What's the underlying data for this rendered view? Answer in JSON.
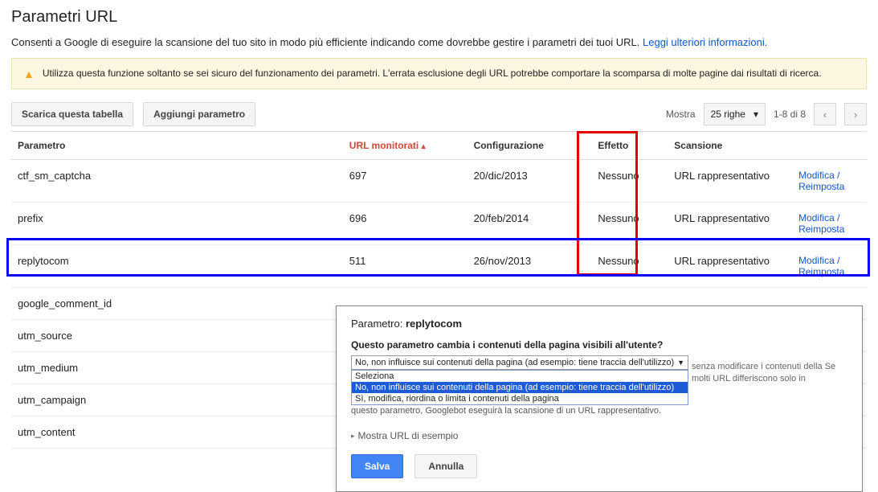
{
  "page": {
    "title": "Parametri URL",
    "subtitle": "Consenti a Google di eseguire la scansione del tuo sito in modo più efficiente indicando come dovrebbe gestire i parametri dei tuoi URL.",
    "learn_more": "Leggi ulteriori informazioni."
  },
  "warning": "Utilizza questa funzione soltanto se sei sicuro del funzionamento dei parametri. L'errata esclusione degli URL potrebbe comportare la scomparsa di molte pagine dai risultati di ricerca.",
  "toolbar": {
    "download": "Scarica questa tabella",
    "add": "Aggiungi parametro",
    "show_label": "Mostra",
    "rows_select": "25 righe",
    "range": "1-8 di 8"
  },
  "table": {
    "headers": {
      "param": "Parametro",
      "monitored": "URL monitorati",
      "config": "Configurazione",
      "effect": "Effetto",
      "scan": "Scansione"
    },
    "rows": [
      {
        "param": "ctf_sm_captcha",
        "monitored": "697",
        "config": "20/dic/2013",
        "effect": "Nessuno",
        "scan": "URL rappresentativo"
      },
      {
        "param": "prefix",
        "monitored": "696",
        "config": "20/feb/2014",
        "effect": "Nessuno",
        "scan": "URL rappresentativo"
      },
      {
        "param": "replytocom",
        "monitored": "511",
        "config": "26/nov/2013",
        "effect": "Nessuno",
        "scan": "URL rappresentativo"
      },
      {
        "param": "google_comment_id"
      },
      {
        "param": "utm_source"
      },
      {
        "param": "utm_medium"
      },
      {
        "param": "utm_campaign"
      },
      {
        "param": "utm_content"
      }
    ],
    "action_edit": "Modifica",
    "action_reset": "Reimposta"
  },
  "modal": {
    "title_prefix": "Parametro:",
    "title_param": "replytocom",
    "question": "Questo parametro cambia i contenuti della pagina visibili all'utente?",
    "select_value": "No, non influisce sui contenuti della pagina (ad esempio: tiene traccia dell'utilizzo)",
    "options": {
      "o0": "Seleziona",
      "o1": "No, non influisce sui contenuti della pagina (ad esempio: tiene traccia dell'utilizzo)",
      "o2": "Sì, modifica, riordina o limita i contenuti della pagina"
    },
    "help_side": "senza modificare i contenuti della Se molti URL differiscono solo in",
    "under_text": "questo parametro, Googlebot eseguirà la scansione di un URL rappresentativo.",
    "example": "Mostra URL di esempio",
    "save": "Salva",
    "cancel": "Annulla"
  }
}
